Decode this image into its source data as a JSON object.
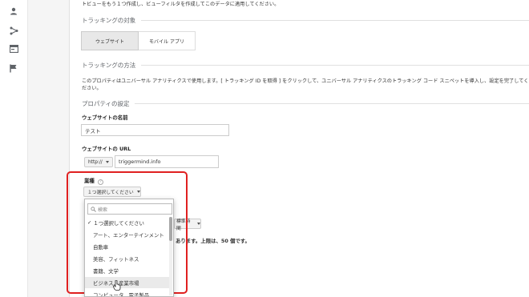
{
  "intro_text": "トビューをもう１つ作成し、ビューフィルタを作成してこのデータに適用してください。",
  "tracking_target": {
    "heading": "トラッキングの対象",
    "tabs": [
      "ウェブサイト",
      "モバイル アプリ"
    ],
    "active_tab": "ウェブサイト"
  },
  "tracking_method": {
    "heading": "トラッキングの方法",
    "line1": "このプロパティはユニバーサル アナリティクスで使用します。[ トラッキング ID を取得 ] をクリックして、ユニバーサル アナリティクスのトラッキング コード スニペットを導入し、設定を完了してく",
    "line2": "ださい。"
  },
  "property_settings": {
    "heading": "プロパティの設定",
    "site_name_label": "ウェブサイトの名前",
    "site_name_value": "テスト",
    "site_url_label": "ウェブサイトの URL",
    "protocol_value": "http://",
    "site_url_value": "triggermind.info",
    "industry_label": "業種",
    "industry_button": "１つ選択してください",
    "timezone_button": "標準時間",
    "limit_text": "あります。上限は、50 個です。"
  },
  "industry_dropdown": {
    "search_placeholder": "検索",
    "options": [
      "１つ選択してください",
      "アート、エンターテインメント",
      "自動車",
      "美容、フィットネス",
      "書籍、文学",
      "ビジネス、産業市場",
      "コンピュータ、電子製品"
    ],
    "selected_index": 0,
    "hover_index": 5
  },
  "colors": {
    "highlight": "#e02020",
    "active_tab": "#e8e8e8"
  }
}
